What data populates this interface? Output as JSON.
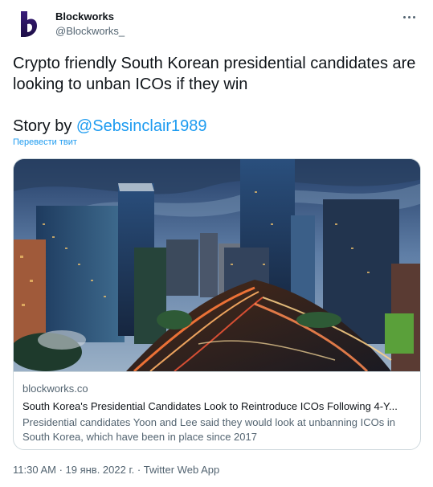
{
  "author": {
    "display_name": "Blockworks",
    "handle": "@Blockworks_",
    "avatar_icon": "blockworks-logo-icon",
    "avatar_color": "#2b1760"
  },
  "more_icon": "more-dots-icon",
  "tweet": {
    "text": "Crypto friendly South Korean presidential candidates are looking to unban ICOs if they win",
    "story_prefix": "Story by ",
    "story_mention": "@Sebsinclair1989",
    "translate_link": "Перевести твит"
  },
  "card": {
    "image_alt": "Night cityscape of Seoul skyscrapers with light trails",
    "domain": "blockworks.co",
    "title": "South Korea's Presidential Candidates Look to Reintroduce ICOs Following 4-Y...",
    "description": "Presidential candidates Yoon and Lee said they would look at unbanning ICOs in South Korea, which have been in place since 2017"
  },
  "meta": {
    "timestamp": "11:30 AM · 19 янв. 2022 г. · Twitter Web App"
  },
  "colors": {
    "link": "#1d9bf0",
    "text": "#0f1419",
    "secondary": "#536471",
    "border": "#cfd9de"
  }
}
